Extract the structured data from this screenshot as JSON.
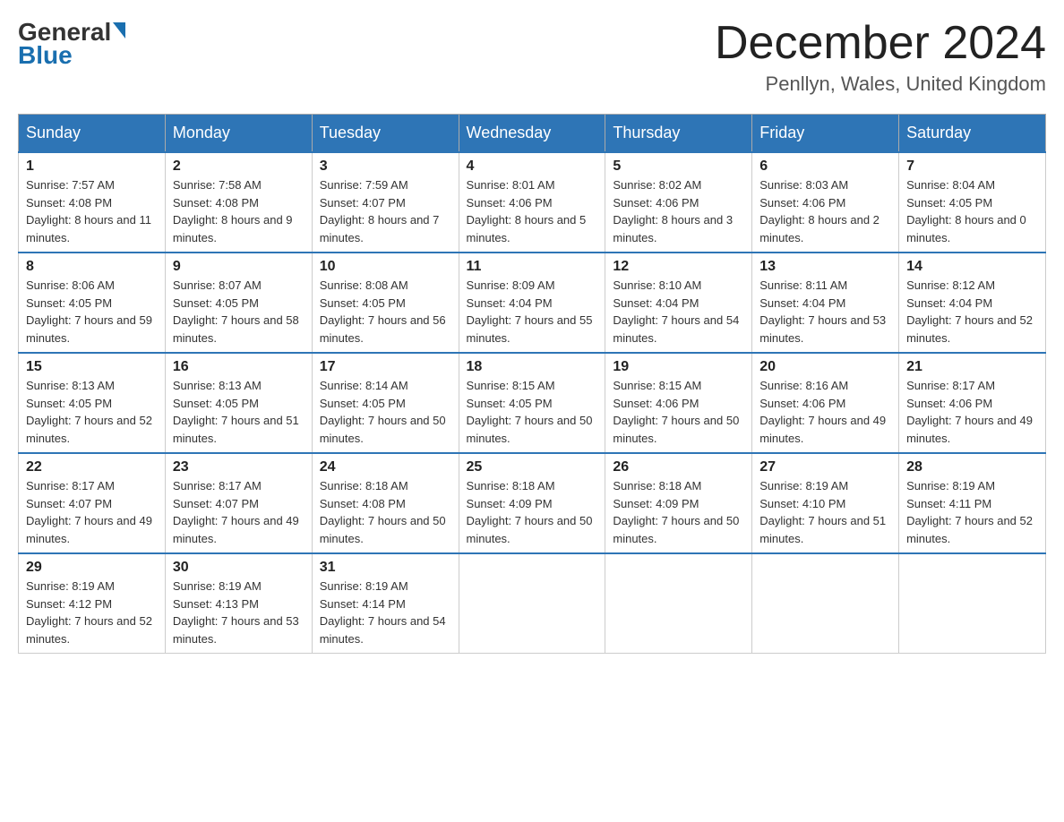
{
  "logo": {
    "general": "General",
    "blue": "Blue"
  },
  "header": {
    "title": "December 2024",
    "subtitle": "Penllyn, Wales, United Kingdom"
  },
  "weekdays": [
    "Sunday",
    "Monday",
    "Tuesday",
    "Wednesday",
    "Thursday",
    "Friday",
    "Saturday"
  ],
  "weeks": [
    [
      {
        "day": "1",
        "sunrise": "7:57 AM",
        "sunset": "4:08 PM",
        "daylight": "8 hours and 11 minutes."
      },
      {
        "day": "2",
        "sunrise": "7:58 AM",
        "sunset": "4:08 PM",
        "daylight": "8 hours and 9 minutes."
      },
      {
        "day": "3",
        "sunrise": "7:59 AM",
        "sunset": "4:07 PM",
        "daylight": "8 hours and 7 minutes."
      },
      {
        "day": "4",
        "sunrise": "8:01 AM",
        "sunset": "4:06 PM",
        "daylight": "8 hours and 5 minutes."
      },
      {
        "day": "5",
        "sunrise": "8:02 AM",
        "sunset": "4:06 PM",
        "daylight": "8 hours and 3 minutes."
      },
      {
        "day": "6",
        "sunrise": "8:03 AM",
        "sunset": "4:06 PM",
        "daylight": "8 hours and 2 minutes."
      },
      {
        "day": "7",
        "sunrise": "8:04 AM",
        "sunset": "4:05 PM",
        "daylight": "8 hours and 0 minutes."
      }
    ],
    [
      {
        "day": "8",
        "sunrise": "8:06 AM",
        "sunset": "4:05 PM",
        "daylight": "7 hours and 59 minutes."
      },
      {
        "day": "9",
        "sunrise": "8:07 AM",
        "sunset": "4:05 PM",
        "daylight": "7 hours and 58 minutes."
      },
      {
        "day": "10",
        "sunrise": "8:08 AM",
        "sunset": "4:05 PM",
        "daylight": "7 hours and 56 minutes."
      },
      {
        "day": "11",
        "sunrise": "8:09 AM",
        "sunset": "4:04 PM",
        "daylight": "7 hours and 55 minutes."
      },
      {
        "day": "12",
        "sunrise": "8:10 AM",
        "sunset": "4:04 PM",
        "daylight": "7 hours and 54 minutes."
      },
      {
        "day": "13",
        "sunrise": "8:11 AM",
        "sunset": "4:04 PM",
        "daylight": "7 hours and 53 minutes."
      },
      {
        "day": "14",
        "sunrise": "8:12 AM",
        "sunset": "4:04 PM",
        "daylight": "7 hours and 52 minutes."
      }
    ],
    [
      {
        "day": "15",
        "sunrise": "8:13 AM",
        "sunset": "4:05 PM",
        "daylight": "7 hours and 52 minutes."
      },
      {
        "day": "16",
        "sunrise": "8:13 AM",
        "sunset": "4:05 PM",
        "daylight": "7 hours and 51 minutes."
      },
      {
        "day": "17",
        "sunrise": "8:14 AM",
        "sunset": "4:05 PM",
        "daylight": "7 hours and 50 minutes."
      },
      {
        "day": "18",
        "sunrise": "8:15 AM",
        "sunset": "4:05 PM",
        "daylight": "7 hours and 50 minutes."
      },
      {
        "day": "19",
        "sunrise": "8:15 AM",
        "sunset": "4:06 PM",
        "daylight": "7 hours and 50 minutes."
      },
      {
        "day": "20",
        "sunrise": "8:16 AM",
        "sunset": "4:06 PM",
        "daylight": "7 hours and 49 minutes."
      },
      {
        "day": "21",
        "sunrise": "8:17 AM",
        "sunset": "4:06 PM",
        "daylight": "7 hours and 49 minutes."
      }
    ],
    [
      {
        "day": "22",
        "sunrise": "8:17 AM",
        "sunset": "4:07 PM",
        "daylight": "7 hours and 49 minutes."
      },
      {
        "day": "23",
        "sunrise": "8:17 AM",
        "sunset": "4:07 PM",
        "daylight": "7 hours and 49 minutes."
      },
      {
        "day": "24",
        "sunrise": "8:18 AM",
        "sunset": "4:08 PM",
        "daylight": "7 hours and 50 minutes."
      },
      {
        "day": "25",
        "sunrise": "8:18 AM",
        "sunset": "4:09 PM",
        "daylight": "7 hours and 50 minutes."
      },
      {
        "day": "26",
        "sunrise": "8:18 AM",
        "sunset": "4:09 PM",
        "daylight": "7 hours and 50 minutes."
      },
      {
        "day": "27",
        "sunrise": "8:19 AM",
        "sunset": "4:10 PM",
        "daylight": "7 hours and 51 minutes."
      },
      {
        "day": "28",
        "sunrise": "8:19 AM",
        "sunset": "4:11 PM",
        "daylight": "7 hours and 52 minutes."
      }
    ],
    [
      {
        "day": "29",
        "sunrise": "8:19 AM",
        "sunset": "4:12 PM",
        "daylight": "7 hours and 52 minutes."
      },
      {
        "day": "30",
        "sunrise": "8:19 AM",
        "sunset": "4:13 PM",
        "daylight": "7 hours and 53 minutes."
      },
      {
        "day": "31",
        "sunrise": "8:19 AM",
        "sunset": "4:14 PM",
        "daylight": "7 hours and 54 minutes."
      },
      null,
      null,
      null,
      null
    ]
  ]
}
